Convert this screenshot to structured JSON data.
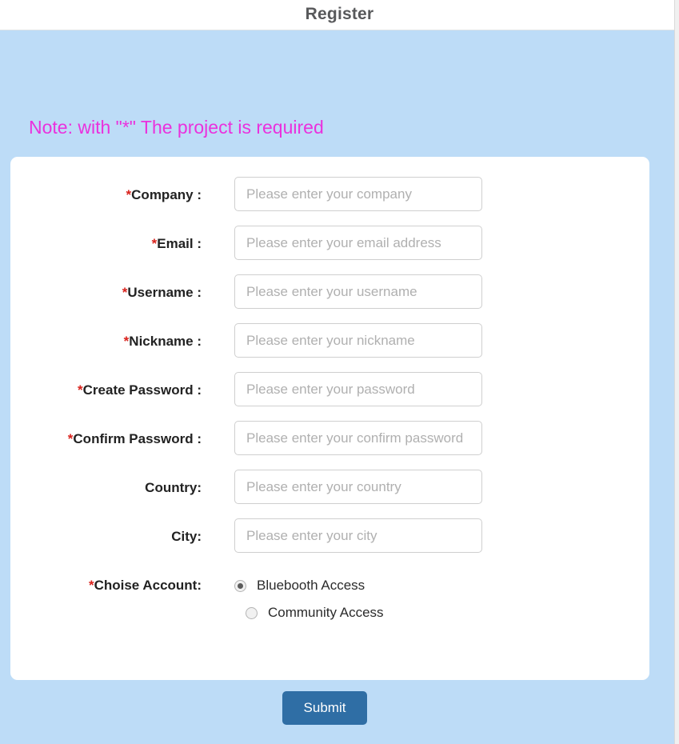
{
  "header": {
    "title": "Register"
  },
  "note": {
    "text": "Note: with \"*\" The project is required",
    "color": "#ea31dd"
  },
  "form": {
    "fields": [
      {
        "label": "Company :",
        "required": true,
        "placeholder": "Please enter your company",
        "value": "",
        "type": "text"
      },
      {
        "label": "Email :",
        "required": true,
        "placeholder": "Please enter your email address",
        "value": "",
        "type": "text"
      },
      {
        "label": "Username :",
        "required": true,
        "placeholder": "Please enter your username",
        "value": "",
        "type": "text"
      },
      {
        "label": "Nickname :",
        "required": true,
        "placeholder": "Please enter your nickname",
        "value": "",
        "type": "text"
      },
      {
        "label": "Create Password :",
        "required": true,
        "placeholder": "Please enter your password",
        "value": "",
        "type": "password"
      },
      {
        "label": "Confirm Password :",
        "required": true,
        "placeholder": "Please enter your confirm password",
        "value": "",
        "type": "password"
      },
      {
        "label": "Country:",
        "required": false,
        "placeholder": "Please enter your country",
        "value": "",
        "type": "text"
      },
      {
        "label": "City:",
        "required": false,
        "placeholder": "Please enter your city",
        "value": "",
        "type": "text"
      }
    ],
    "account_choice": {
      "label": "Choise Account:",
      "required": true,
      "options": [
        {
          "label": "Bluebooth Access",
          "selected": true
        },
        {
          "label": "Community Access",
          "selected": false
        }
      ]
    }
  },
  "actions": {
    "submit_label": "Submit",
    "submit_color": "#2f6ea5"
  },
  "theme": {
    "page_background": "#bddcf7",
    "card_background": "#ffffff",
    "header_background": "#ffffff",
    "label_color": "#222222",
    "required_star_color": "#d9221c",
    "placeholder_color": "#b0b0b0"
  }
}
